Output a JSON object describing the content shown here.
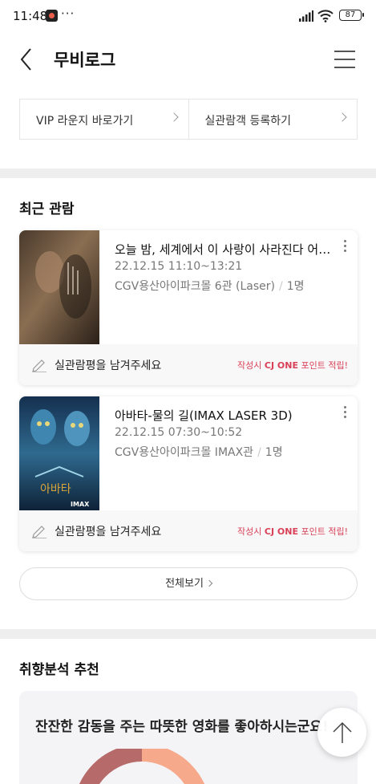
{
  "status": {
    "time": "11:48",
    "dots": "···",
    "battery": "87"
  },
  "header": {
    "title": "무비로그"
  },
  "quick_links": [
    {
      "label": "VIP 라운지 바로가기"
    },
    {
      "label": "실관람객 등록하기"
    }
  ],
  "recent": {
    "title": "최근 관람",
    "items": [
      {
        "title": "오늘 밤, 세계에서 이 사랑이 사라진다 어쩌구",
        "time": "22.12.15 11:10~13:21",
        "theater": "CGV용산아이파크몰 6관 (Laser)",
        "people": "1명",
        "review": "실관람평을 남겨주세요",
        "promo_prefix": "작성시 ",
        "promo_brand": "CJ ONE",
        "promo_suffix": " 포인트 적립!"
      },
      {
        "title": "아바타-물의 길(IMAX LASER 3D)",
        "time": "22.12.15 07:30~10:52",
        "theater": "CGV용산아이파크몰 IMAX관",
        "people": "1명",
        "review": "실관람평을 남겨주세요",
        "promo_prefix": "작성시 ",
        "promo_brand": "CJ ONE",
        "promo_suffix": " 포인트 적립!",
        "poster_text": "아바타",
        "poster_badge": "IMAX"
      }
    ],
    "view_all": "전체보기"
  },
  "taste": {
    "title": "취향분석 추천",
    "headline": "잔잔한 감동을 주는 따뜻한 영화를 좋아하시는군요!"
  },
  "colors": {
    "accent": "#d94057",
    "divider": "#eeeeee"
  }
}
